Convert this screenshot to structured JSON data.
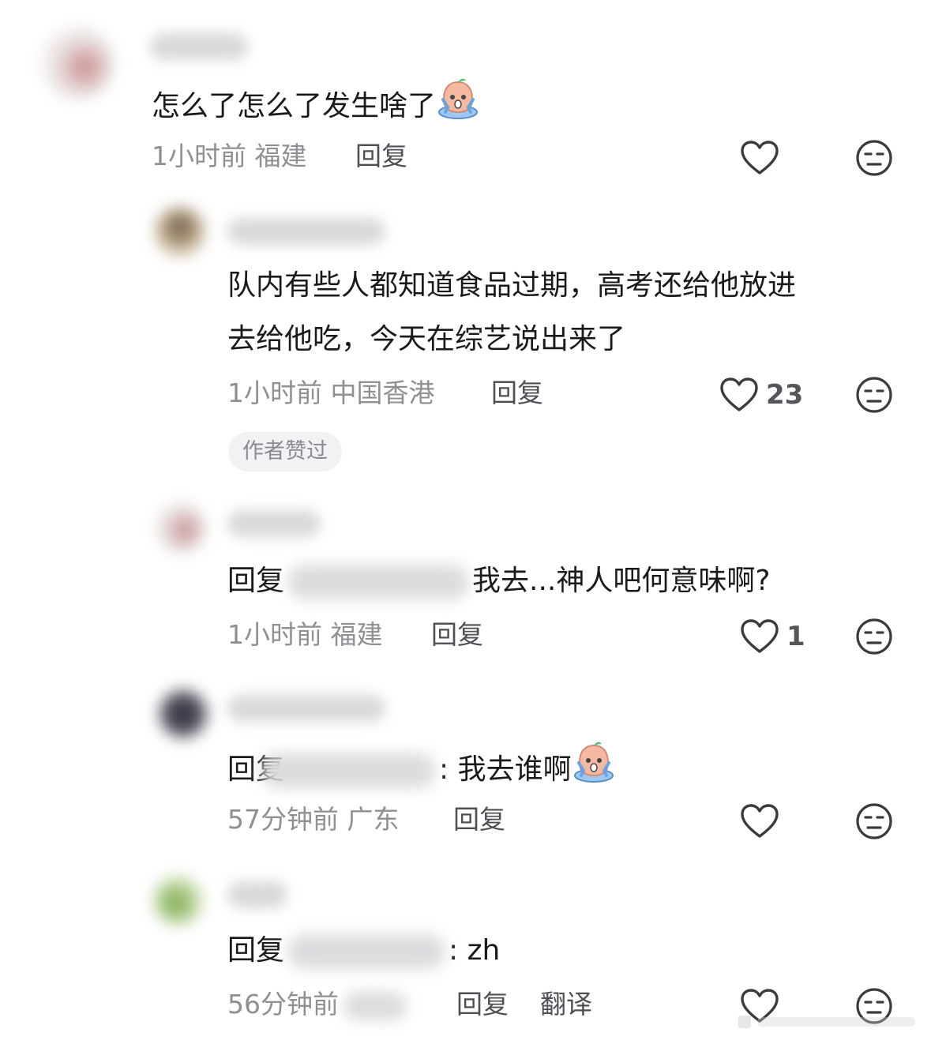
{
  "comments": [
    {
      "text": "怎么了怎么了发生啥了",
      "time_location": "1小时前 福建",
      "reply_label": "回复",
      "likes": ""
    },
    {
      "text_line1": "队内有些人都知道食品过期，高考还给他放进",
      "text_line2": "去给他吃，今天在综艺说出来了",
      "time_location": "1小时前 中国香港",
      "reply_label": "回复",
      "likes": "23",
      "badge": "作者赞过"
    },
    {
      "prefix": "回复",
      "text": "我去...神人吧何意味啊?",
      "time_location": "1小时前 福建",
      "reply_label": "回复",
      "likes": "1"
    },
    {
      "prefix": "回复",
      "text": ": 我去谁啊",
      "time_location": "57分钟前 广东",
      "reply_label": "回复",
      "likes": ""
    },
    {
      "prefix": "回复",
      "text": ": zh",
      "time_location": "56分钟前",
      "reply_label": "回复",
      "translate_label": "翻译"
    }
  ],
  "icons": {
    "like": "heart-outline-icon",
    "dislike": "neutral-face-icon",
    "emoji": "crying-face-emoji"
  },
  "colors": {
    "text": "#1a1a1a",
    "meta": "#8f8f94",
    "icon": "#3a3a3f",
    "badge_bg": "#f2f2f4"
  }
}
